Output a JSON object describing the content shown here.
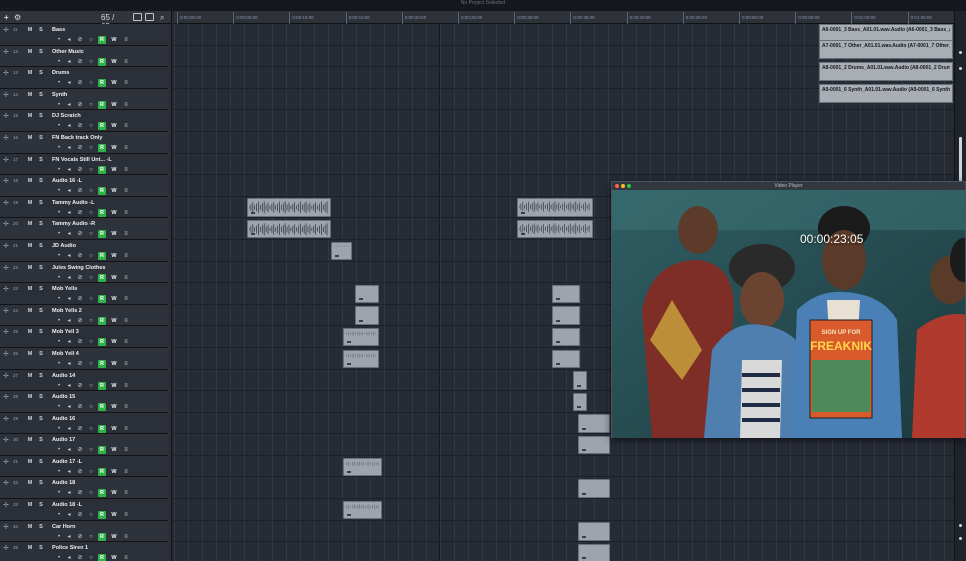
{
  "window": {
    "title": "No Project Selected"
  },
  "toolbar": {
    "add_track": "+",
    "presets": "⚙",
    "track_count": "65 / 65",
    "search": "⌕"
  },
  "track_controls": {
    "mute": "M",
    "solo": "S",
    "record": "R",
    "write": "W",
    "monitor_icon": "•",
    "listen_icon": "◂",
    "phase_icon": "⊘",
    "input_icon": "○",
    "edit_icon": "≡"
  },
  "tracks": [
    {
      "num": "11",
      "name": "Bass"
    },
    {
      "num": "12",
      "name": "Other Music"
    },
    {
      "num": "13",
      "name": "Drums"
    },
    {
      "num": "14",
      "name": "Synth"
    },
    {
      "num": "15",
      "name": "DJ Scratch"
    },
    {
      "num": "16",
      "name": "FN Back track Only"
    },
    {
      "num": "17",
      "name": "FN Vocals Still Unt... -L"
    },
    {
      "num": "18",
      "name": "Audio 16 -L"
    },
    {
      "num": "19",
      "name": "Tammy Audio -L"
    },
    {
      "num": "20",
      "name": "Tammy Audio -R"
    },
    {
      "num": "21",
      "name": "JD Audio"
    },
    {
      "num": "22",
      "name": "Jules Swing Clothes"
    },
    {
      "num": "23",
      "name": "Mob Yells"
    },
    {
      "num": "24",
      "name": "Mob Yells 2"
    },
    {
      "num": "25",
      "name": "Mob Yell 3"
    },
    {
      "num": "26",
      "name": "Mob Yell 4"
    },
    {
      "num": "27",
      "name": "Audio 14"
    },
    {
      "num": "28",
      "name": "Audio 15"
    },
    {
      "num": "29",
      "name": "Audio 16"
    },
    {
      "num": "30",
      "name": "Audio 17"
    },
    {
      "num": "31",
      "name": "Audio 17 -L"
    },
    {
      "num": "32",
      "name": "Audio 18"
    },
    {
      "num": "33",
      "name": "Audio 18 -L"
    },
    {
      "num": "34",
      "name": "Car Horn"
    },
    {
      "num": "35",
      "name": "Police Siren 1"
    }
  ],
  "ruler": {
    "ticks": [
      "0:00:00:00",
      "0:00:05:00",
      "0:00:10:00",
      "0:00:15:00",
      "0:00:20:00",
      "0:00:25:00",
      "0:00:30:00",
      "0:00:35:00",
      "0:00:40:00",
      "0:00:45:00",
      "0:00:50:00",
      "0:00:55:00",
      "0:01:00:00",
      "0:01:05:00"
    ]
  },
  "top_clips": [
    "A6-0001_3 Bass_A01.01.wav.Audio (A6-0001_3 Bass_A",
    "A7-0001_7 Other_A01.01.wav.Audio (A7-0001_7 Other_",
    "A8-0001_2 Drums_A01.01.wav.Audio (A8-0001_2 Drum",
    "A9-0001_6 Synth_A01.01.wav.Audio (A9-0001_6 Synth_"
  ],
  "video_player": {
    "title": "Video Player",
    "timecode": "00:00:23:05",
    "poster_text_top": "SIGN UP FOR",
    "poster_text_main": "FREAKNIK"
  }
}
